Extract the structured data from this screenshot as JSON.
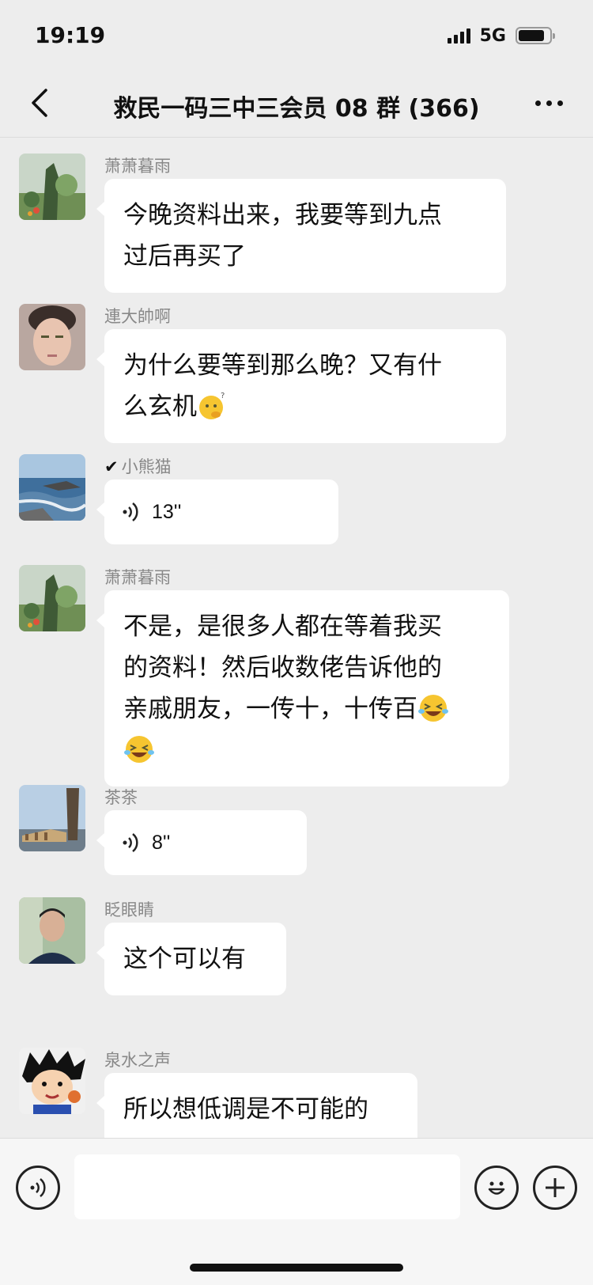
{
  "status_bar": {
    "time": "19:19",
    "network": "5G",
    "battery_level": 0.85
  },
  "header": {
    "title": "救民一码三中三会员 08 群 (366)",
    "back_icon": "chevron-left-icon",
    "more_icon": "more-dots-icon"
  },
  "messages": [
    {
      "sender": "萧萧暮雨",
      "type": "text",
      "lines": [
        "今晚资料出来，我要等到九点",
        "过后再买了"
      ]
    },
    {
      "sender": "連大帥啊",
      "type": "text",
      "lines": [
        "为什么要等到那么晚？又有什",
        "么玄机"
      ],
      "trailing_emoji": "thinking-emoji"
    },
    {
      "sender": "小熊猫",
      "sender_prefix": "✔",
      "type": "voice",
      "duration": "13''"
    },
    {
      "sender": "萧萧暮雨",
      "type": "text",
      "lines": [
        "不是，是很多人都在等着我买",
        "的资料！然后收数佬告诉他的",
        "亲戚朋友，一传十，十传百"
      ],
      "trailing_emoji": "laugh-cry-emoji"
    },
    {
      "sender": "茶茶",
      "type": "voice",
      "duration": "8''"
    },
    {
      "sender": "眨眼睛",
      "type": "text",
      "lines": [
        "这个可以有"
      ]
    },
    {
      "sender": "泉水之声",
      "type": "text",
      "lines": [
        "所以想低调是不可能的"
      ]
    }
  ],
  "input_bar": {
    "voice_icon": "voice-mode-icon",
    "emoji_icon": "smiley-icon",
    "plus_icon": "plus-icon",
    "placeholder": ""
  },
  "colors": {
    "background": "#ededed",
    "bubble": "#ffffff",
    "sender_name": "#888888"
  }
}
